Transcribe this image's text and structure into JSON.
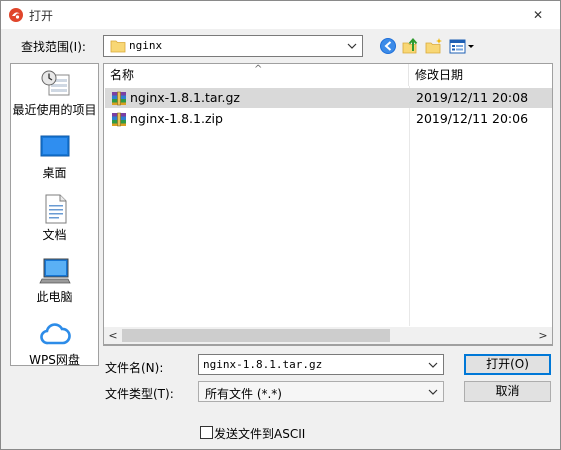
{
  "window": {
    "title": "打开",
    "close_glyph": "✕",
    "icon": "app-logo-icon"
  },
  "toolbar": {
    "lookin_label": "查找范围(I):",
    "lookin_value": "nginx",
    "buttons": [
      "back-icon",
      "up-folder-icon",
      "new-folder-icon",
      "view-menu-icon"
    ]
  },
  "places": [
    {
      "label": "最近使用的项目",
      "icon": "recent-items-icon"
    },
    {
      "label": "桌面",
      "icon": "desktop-icon"
    },
    {
      "label": "文档",
      "icon": "documents-icon"
    },
    {
      "label": "此电脑",
      "icon": "this-pc-icon"
    },
    {
      "label": "WPS网盘",
      "icon": "wps-cloud-icon"
    }
  ],
  "filelist": {
    "columns": {
      "name": "名称",
      "date": "修改日期"
    },
    "files": [
      {
        "name": "nginx-1.8.1.tar.gz",
        "date": "2019/12/11 20:08",
        "selected": true,
        "icon": "archive-icon"
      },
      {
        "name": "nginx-1.8.1.zip",
        "date": "2019/12/11 20:06",
        "selected": false,
        "icon": "archive-icon"
      }
    ]
  },
  "footer": {
    "filename_label": "文件名(N):",
    "filename_value": "nginx-1.8.1.tar.gz",
    "filetype_label": "文件类型(T):",
    "filetype_value": "所有文件 (*.*)",
    "open_button": "打开(O)",
    "cancel_button": "取消",
    "ascii_label": "发送文件到ASCII",
    "ascii_checked": false
  },
  "colors": {
    "selected_row": "#d9d9d9",
    "default_button_border": "#0078d7",
    "app_icon_red": "#e0452b"
  }
}
